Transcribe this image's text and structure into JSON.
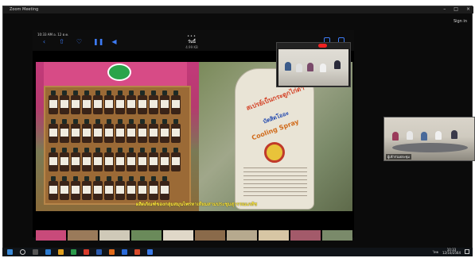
{
  "window": {
    "title": "Zoom Meeting",
    "controls": [
      "–",
      "□",
      "×"
    ],
    "sign_in": "Sign in"
  },
  "shared_screen": {
    "status_time": "10:33 AM  อ. 12 ต.ค.",
    "doc_title": "วันนี้",
    "doc_size": "4.99 KB",
    "toolbar_icons": [
      "back-icon",
      "share-icon",
      "heart-icon",
      "pause-icon",
      "volume-icon"
    ],
    "caption": "ผลิตภัณฑ์ของกลุ่มสมุนไพรทาเทียมสามประชุมสุวรรณเภสัช"
  },
  "spray_label": {
    "line1": "สเปรย์เบ็นกระดูกไก่ดำ",
    "line2": "บัตสิดโออะ",
    "line3": "Cooling Spray"
  },
  "self_video": {
    "rec_label": "●"
  },
  "participant_video": {
    "name": "ผู้เข้าร่วมประชุม"
  },
  "taskbar": {
    "clock_time": "10:33",
    "clock_date": "12/10/2564",
    "lang": "ไทย"
  },
  "colors": {
    "zoom_bg": "#0b0b0b",
    "accent": "#3d7bf5",
    "caption": "#ffe93a",
    "rec": "#ee2222"
  }
}
